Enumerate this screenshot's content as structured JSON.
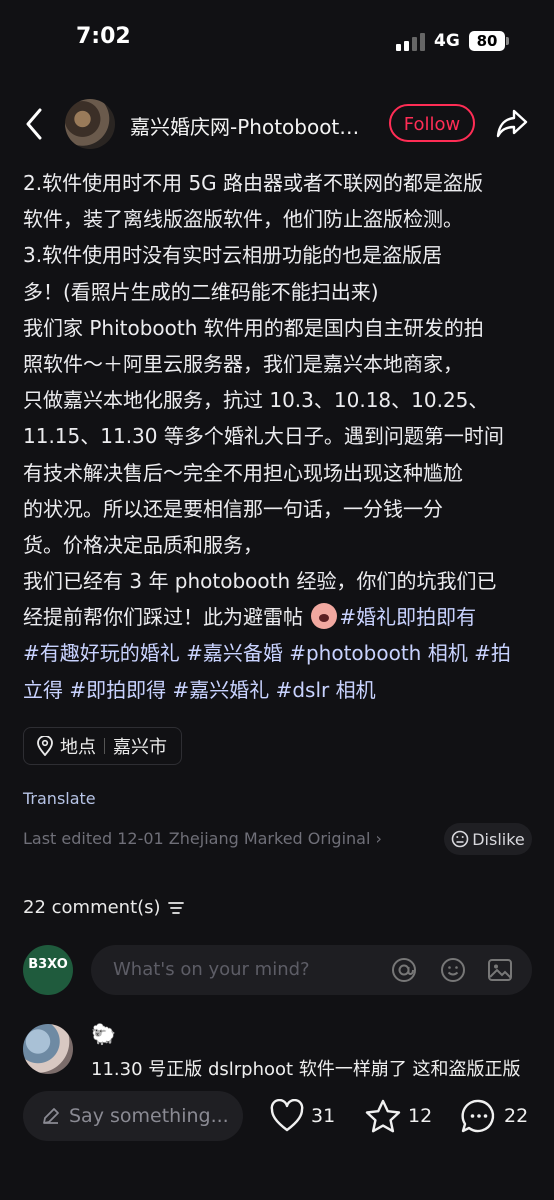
{
  "status": {
    "time": "7:02",
    "network": "4G",
    "battery": "80"
  },
  "header": {
    "author": "嘉兴婚庆网-Photoboot…",
    "follow_label": "Follow"
  },
  "post": {
    "lines": [
      "2.软件使用时不用 5G 路由器或者不联网的都是盗版",
      "软件，装了离线版盗版软件，他们防止盗版检测。",
      "3.软件使用时没有实时云相册功能的也是盗版居",
      "多！(看照片生成的二维码能不能扫出来)",
      "我们家 Phitobooth 软件用的都是国内自主研发的拍",
      "照软件～＋阿里云服务器，我们是嘉兴本地商家，",
      "只做嘉兴本地化服务，抗过 10.3、10.18、10.25、",
      "11.15、11.30 等多个婚礼大日子。遇到问题第一时间",
      "有技术解决售后～完全不用担心现场出现这种尴尬",
      "的状况。所以还是要相信那一句话，一分钱一分",
      "货。价格决定品质和服务，",
      "我们已经有 3 年 photobooth 经验，你们的坑我们已"
    ],
    "line13_text": "经提前帮你们踩过！此为避雷帖 ",
    "tags": [
      "#婚礼即拍即有",
      "#有趣好玩的婚礼",
      "#嘉兴备婚",
      "#photobooth相机",
      "#拍立得",
      "#即拍即得",
      "#嘉兴婚礼",
      "#dslr相机"
    ],
    "tag_display": {
      "t1": "#婚礼即拍即有",
      "line14": "#有趣好玩的婚礼 #嘉兴备婚 #photobooth 相机 #拍",
      "line15": "立得 #即拍即得 #嘉兴婚礼 #dslr 相机"
    }
  },
  "location": {
    "label": "地点",
    "value": "嘉兴市"
  },
  "translate_label": "Translate",
  "meta": "Last edited 12-01 Zhejiang Marked Original",
  "dislike_label": "Dislike",
  "comments": {
    "count_label": "22 comment(s)",
    "input_placeholder": "What's on your mind?",
    "my_avatar_text": "B3XO",
    "first": {
      "name": "🐑",
      "text": "11.30 号正版 dslrphoot 软件一样崩了 这和盗版正版"
    }
  },
  "bottom_bar": {
    "say_placeholder": "Say something...",
    "likes": "31",
    "stars": "12",
    "comments": "22"
  },
  "colors": {
    "accent": "#ff2d55",
    "tag": "#c9d3ff",
    "background": "#111114"
  },
  "icons": [
    "back-icon",
    "share-icon",
    "location-pin-icon",
    "dislike-face-icon",
    "filter-icon",
    "at-icon",
    "emoji-icon",
    "image-icon",
    "pencil-icon",
    "heart-icon",
    "star-icon",
    "comment-icon"
  ]
}
